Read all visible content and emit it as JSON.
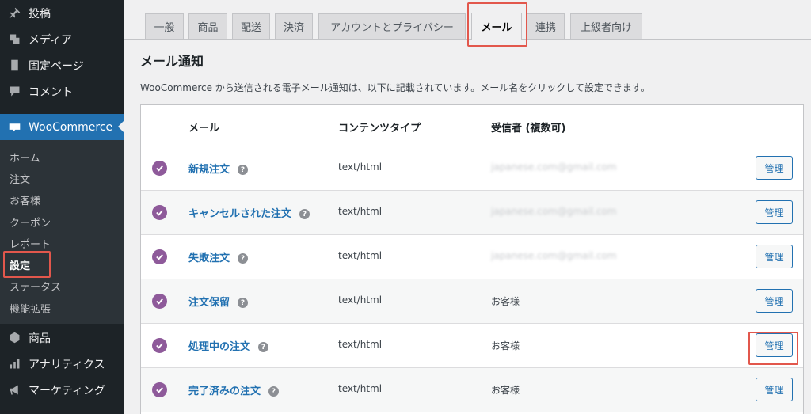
{
  "sidebar": {
    "top_items": [
      {
        "label": "投稿",
        "icon": "pin-icon"
      },
      {
        "label": "メディア",
        "icon": "media-icon"
      },
      {
        "label": "固定ページ",
        "icon": "page-icon"
      },
      {
        "label": "コメント",
        "icon": "comment-icon"
      }
    ],
    "woocommerce": {
      "label": "WooCommerce",
      "icon": "woo-icon"
    },
    "submenu": [
      "ホーム",
      "注文",
      "お客様",
      "クーポン",
      "レポート",
      "設定",
      "ステータス",
      "機能拡張"
    ],
    "current_submenu": "設定",
    "bottom_items": [
      {
        "label": "商品",
        "icon": "box-icon"
      },
      {
        "label": "アナリティクス",
        "icon": "chart-icon"
      },
      {
        "label": "マーケティング",
        "icon": "megaphone-icon"
      }
    ]
  },
  "tabs": [
    "一般",
    "商品",
    "配送",
    "決済",
    "アカウントとプライバシー",
    "メール",
    "連携",
    "上級者向け"
  ],
  "active_tab": "メール",
  "page": {
    "title": "メール通知",
    "description": "WooCommerce から送信される電子メール通知は、以下に記載されています。メール名をクリックして設定できます。"
  },
  "table": {
    "headers": {
      "email": "メール",
      "content_type": "コンテンツタイプ",
      "recipients": "受信者 (複数可)"
    },
    "rows": [
      {
        "name": "新規注文",
        "content_type": "text/html",
        "recipient": "japanese.com@gmail.com",
        "blurred": true,
        "action": "管理"
      },
      {
        "name": "キャンセルされた注文",
        "content_type": "text/html",
        "recipient": "japanese.com@gmail.com",
        "blurred": true,
        "action": "管理"
      },
      {
        "name": "失敗注文",
        "content_type": "text/html",
        "recipient": "japanese.com@gmail.com",
        "blurred": true,
        "action": "管理"
      },
      {
        "name": "注文保留",
        "content_type": "text/html",
        "recipient": "お客様",
        "blurred": false,
        "action": "管理"
      },
      {
        "name": "処理中の注文",
        "content_type": "text/html",
        "recipient": "お客様",
        "blurred": false,
        "action": "管理"
      },
      {
        "name": "完了済みの注文",
        "content_type": "text/html",
        "recipient": "お客様",
        "blurred": false,
        "action": "管理"
      }
    ]
  },
  "colors": {
    "accent": "#2271b1",
    "sidebar": "#1d2327",
    "highlight": "#e2574c",
    "check": "#8e5a9a"
  }
}
